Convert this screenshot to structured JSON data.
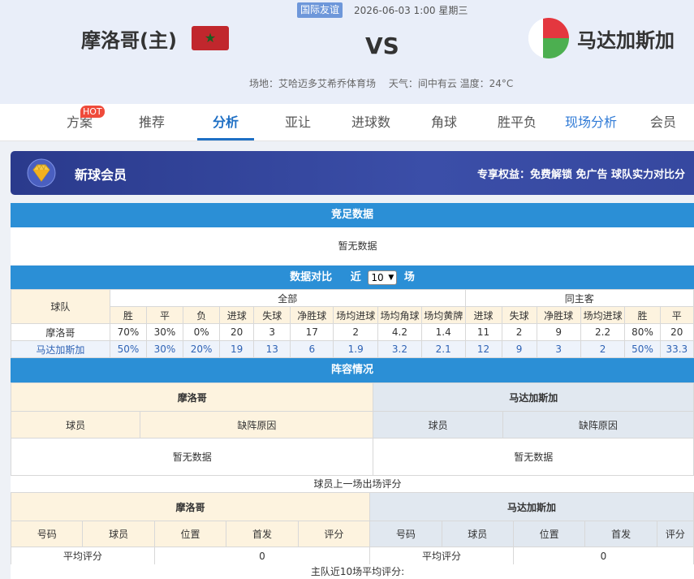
{
  "match": {
    "competition": "国际友谊",
    "datetime": "2026-06-03 1:00 星期三",
    "home_team": "摩洛哥(主)",
    "vs": "VS",
    "away_team": "马达加斯加",
    "venue": "场地：艾哈迈多艾希乔体育场　 天气：间中有云 温度：24°C"
  },
  "tabs": [
    {
      "label": "方案"
    },
    {
      "label": "推荐"
    },
    {
      "label": "分析"
    },
    {
      "label": "亚让"
    },
    {
      "label": "进球数"
    },
    {
      "label": "角球"
    },
    {
      "label": "胜平负"
    },
    {
      "label": "现场分析"
    },
    {
      "label": "会员"
    }
  ],
  "hot_badge": "HOT",
  "vip": {
    "title": "新球会员",
    "perks": "专享权益：免费解锁 免广告 球队实力对比分"
  },
  "jingzu": {
    "title": "竞足数据",
    "empty": "暂无数据"
  },
  "compare": {
    "title": "数据对比",
    "recent_prefix": "近",
    "recent_value": "10",
    "recent_suffix": "场",
    "team_header": "球队",
    "group_all": "全部",
    "group_same": "同主客",
    "cols_all": [
      "胜",
      "平",
      "负",
      "进球",
      "失球",
      "净胜球",
      "场均进球",
      "场均角球",
      "场均黄牌"
    ],
    "cols_same": [
      "进球",
      "失球",
      "净胜球",
      "场均进球",
      "胜",
      "平"
    ],
    "rows": [
      {
        "team": "摩洛哥",
        "all": [
          "70%",
          "30%",
          "0%",
          "20",
          "3",
          "17",
          "2",
          "4.2",
          "1.4"
        ],
        "same": [
          "11",
          "2",
          "9",
          "2.2",
          "80%",
          "20"
        ]
      },
      {
        "team": "马达加斯加",
        "all": [
          "50%",
          "30%",
          "20%",
          "19",
          "13",
          "6",
          "1.9",
          "3.2",
          "2.1"
        ],
        "same": [
          "12",
          "9",
          "3",
          "2",
          "50%",
          "33.3"
        ]
      }
    ]
  },
  "lineup": {
    "title": "阵容情况",
    "home_team": "摩洛哥",
    "away_team": "马达加斯加",
    "col_player": "球员",
    "col_reason": "缺阵原因",
    "empty": "暂无数据"
  },
  "ratings": {
    "caption": "球员上一场出场评分",
    "home_team": "摩洛哥",
    "away_team": "马达加斯加",
    "cols": [
      "号码",
      "球员",
      "位置",
      "首发",
      "评分"
    ],
    "avg_label": "平均评分",
    "home_avg": "0",
    "away_avg": "0",
    "footer": "主队近10场平均评分:"
  },
  "colors": {
    "accent": "#1e6fc4",
    "section_bar": "#2b8fd6",
    "home_bg": "#fdf3df",
    "away_bg": "#e1e8f0",
    "vip_bg": "#3b4ea8",
    "hot": "#ef4b3b"
  }
}
